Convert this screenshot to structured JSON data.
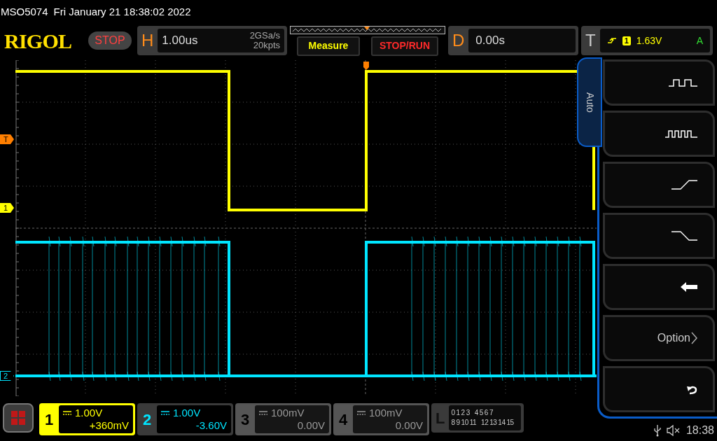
{
  "header": {
    "model": "MSO5074",
    "datetime": "Fri January 21 18:38:02 2022"
  },
  "toolbar": {
    "logo": "RIGOL",
    "run_state": "STOP",
    "horizontal": {
      "label": "H",
      "timebase": "1.00us",
      "sample_rate": "2GSa/s",
      "memory": "20kpts"
    },
    "buttons": [
      "Measure",
      "STOP/RUN"
    ],
    "delay": {
      "label": "D",
      "value": "0.00s"
    },
    "trigger": {
      "label": "T",
      "source": "1",
      "level": "1.63V",
      "mode": "A"
    }
  },
  "markers": [
    {
      "label": "T",
      "filled": true,
      "color": "#ff7f00"
    },
    {
      "label": "1",
      "filled": true,
      "color": "#ffff00"
    },
    {
      "label": "2",
      "filled": false,
      "color": "#00e5ff"
    }
  ],
  "side_menu": {
    "tab": "Auto",
    "items": [
      {
        "kind": "square-wave"
      },
      {
        "kind": "pulse-train"
      },
      {
        "kind": "rising-edge"
      },
      {
        "kind": "falling-edge"
      },
      {
        "kind": "back"
      },
      {
        "kind": "option",
        "label": "Option"
      },
      {
        "kind": "undo"
      }
    ]
  },
  "channels": [
    {
      "number": "1",
      "scale": "1.00V",
      "offset": "+360mV",
      "selected": true,
      "on": true,
      "color": "#ffff00"
    },
    {
      "number": "2",
      "scale": "1.00V",
      "offset": "-3.60V",
      "selected": false,
      "on": true,
      "color": "#00e5ff"
    },
    {
      "number": "3",
      "scale": "100mV",
      "offset": "0.00V",
      "selected": false,
      "on": false,
      "color": "#999999"
    },
    {
      "number": "4",
      "scale": "100mV",
      "offset": "0.00V",
      "selected": false,
      "on": false,
      "color": "#999999"
    }
  ],
  "logic": {
    "label": "L",
    "rows": [
      [
        [
          "0",
          "1",
          "2",
          "3"
        ],
        [
          "4",
          "5",
          "6",
          "7"
        ]
      ],
      [
        [
          "8",
          "9",
          "10",
          "11"
        ],
        [
          "12",
          "13",
          "14",
          "15"
        ]
      ]
    ]
  },
  "status_bar": {
    "time": "18:38"
  }
}
